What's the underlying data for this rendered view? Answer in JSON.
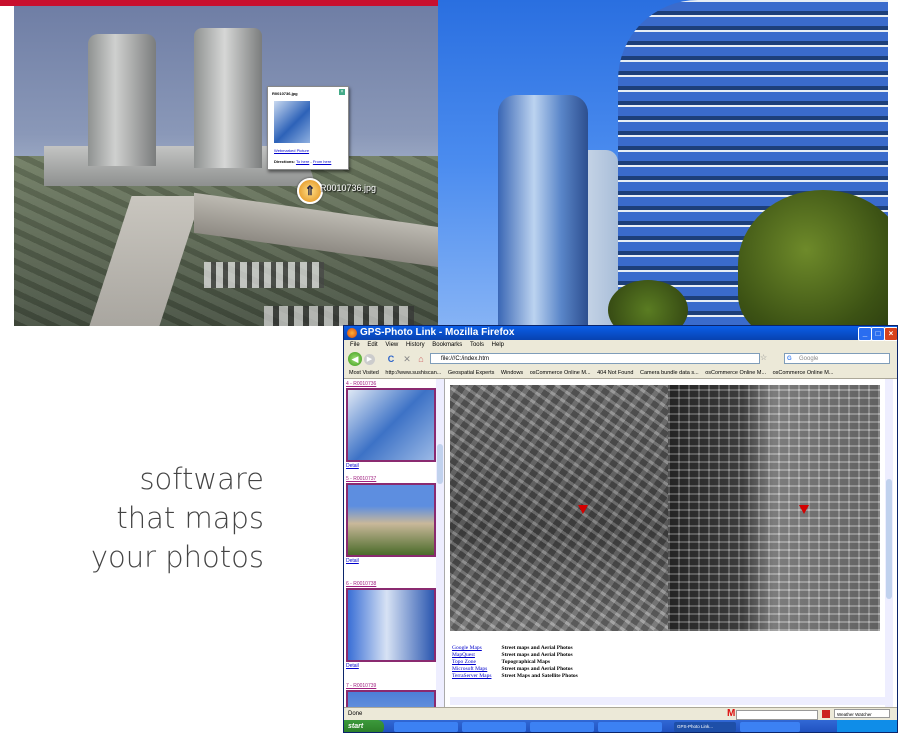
{
  "earth_view": {
    "balloon": {
      "title": "R0010736.jpg",
      "link": "Webmarked Picture",
      "directions_label": "Directions:",
      "to_here": "To here",
      "from_here": "From here"
    },
    "pin_label": "R0010736.jpg"
  },
  "tagline": [
    "software",
    "that maps",
    "your photos"
  ],
  "firefox": {
    "title": "GPS-Photo Link - Mozilla Firefox",
    "menu": [
      "File",
      "Edit",
      "View",
      "History",
      "Bookmarks",
      "Tools",
      "Help"
    ],
    "url": "file:///C:/index.htm",
    "search_placeholder": "Google",
    "bookmarks": [
      "Most Visited",
      "http://www.sushiscan...",
      "Geospatial Experts",
      "Windows",
      "osCommerce Online M...",
      "404 Not Found",
      "Camera bundle data s...",
      "osCommerce Online M...",
      "osCommerce Online M..."
    ],
    "sidebar": [
      {
        "label": "4 - R0010736",
        "link": "Detail"
      },
      {
        "label": "5 - R0010737",
        "link": "Detail"
      },
      {
        "label": "6 - R0010738",
        "link": "Detail"
      },
      {
        "label": "7 - R0010739",
        "link": ""
      }
    ],
    "map_links": [
      {
        "name": "Google Maps",
        "desc": "Street maps and Aerial Photos"
      },
      {
        "name": "MapQuest",
        "desc": "Street maps and Aerial Photos"
      },
      {
        "name": "Topo Zone",
        "desc": "Topographical Maps"
      },
      {
        "name": "Microsoft Maps",
        "desc": "Street maps and Aerial Photos"
      },
      {
        "name": "TerraServer Maps",
        "desc": "Street Maps and Satellite Photos"
      }
    ],
    "status": "Done",
    "addon_label": "Weather Watcher",
    "taskbar": {
      "start": "start",
      "tasks": [
        "",
        "",
        "",
        "",
        "GPS-Photo Link...",
        ""
      ]
    }
  }
}
